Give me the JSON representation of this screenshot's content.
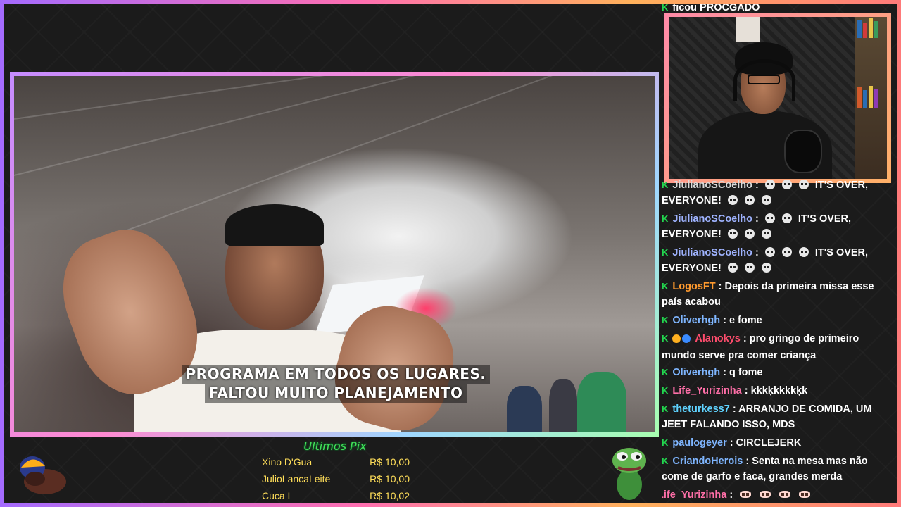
{
  "chat": {
    "top_partial": "ficou PROCGADO",
    "messages": [
      {
        "user": "JiulianoSCoelho",
        "color": "#d9d9d9",
        "text_line1": "IT'S OVER,",
        "text_line2": "EVERYONE!",
        "skulls_before": 3,
        "skulls_after": 3
      },
      {
        "user": "JiulianoSCoelho",
        "color": "#9fb3ff",
        "text_line1": "IT'S OVER,",
        "text_line2": "EVERYONE!",
        "skulls_before": 2,
        "skulls_after": 3
      },
      {
        "user": "JiulianoSCoelho",
        "color": "#9fb3ff",
        "text_line1": "IT'S OVER,",
        "text_line2": "EVERYONE!",
        "skulls_before": 3,
        "skulls_after": 3
      },
      {
        "user": "LogosFT",
        "color": "#ff9a2e",
        "text": "Depois da primeira missa esse país acabou"
      },
      {
        "user": "Oliverhgh",
        "color": "#7fb6ff",
        "text": "e fome"
      },
      {
        "user": "Alanokys",
        "color": "#ff4d6d",
        "text": "pro gringo de primeiro mundo serve pra comer criança"
      },
      {
        "user": "Oliverhgh",
        "color": "#7fb6ff",
        "text": "q fome"
      },
      {
        "user": "Life_Yurizinha",
        "color": "#ff6fa8",
        "text": "kkkķkkkkķk"
      },
      {
        "user": "theturkess7",
        "color": "#5fd3ff",
        "text": "ARRANJO DE COMIDA, UM JEET FALANDO ISSO, MDS"
      },
      {
        "user": "paulogeyer",
        "color": "#7fb6ff",
        "text": "CIRCLEJERK"
      },
      {
        "user": "CriandoHerois",
        "color": "#7fb6ff",
        "text": "Senta na mesa mas não come de garfo e faca, grandes merda"
      },
      {
        "user": "Life_Yurizinha",
        "color": "#ff6fa8",
        "text": ""
      }
    ]
  },
  "video": {
    "subtitle_line1": "PROGRAMA EM TODOS OS LUGARES.",
    "subtitle_line2": "FALTOU MUITO PLANEJAMENTO"
  },
  "pix": {
    "title": "Ultimos Pix",
    "entries": [
      {
        "name": "Xino D'Gua",
        "amount": "R$ 10,00"
      },
      {
        "name": "JulioLancaLeite",
        "amount": "R$ 10,00"
      },
      {
        "name": "Cuca L",
        "amount": "R$ 10,02"
      }
    ]
  },
  "colors": {
    "pix_title": "#44e05a",
    "pix_text": "#ffde59",
    "badge_green": "#22d64e"
  },
  "icons": {
    "chat_badge": "k-badge-icon",
    "skull": "skull-emote-icon",
    "eyes": "eyes-emote-icon"
  }
}
